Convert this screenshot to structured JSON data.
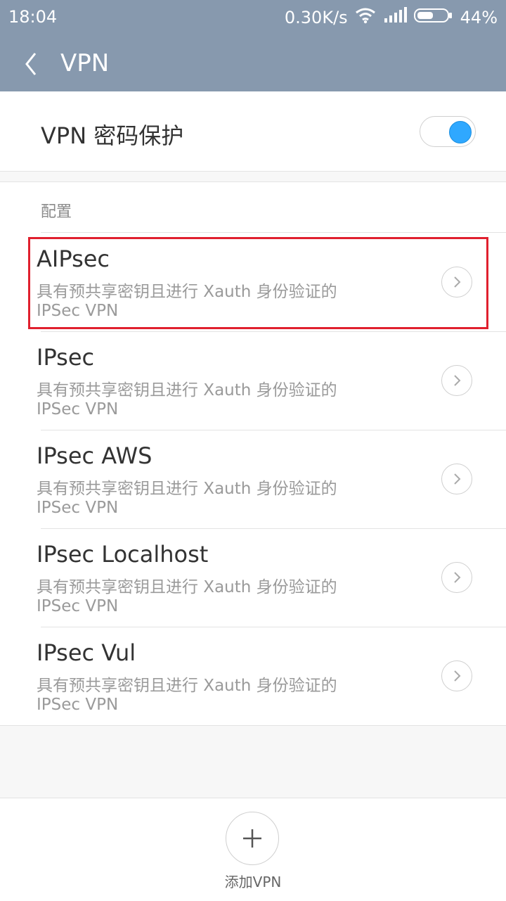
{
  "status_bar": {
    "time": "18:04",
    "speed": "0.30K/s",
    "battery": "44%"
  },
  "header": {
    "title": "VPN"
  },
  "password_protection": {
    "label": "VPN 密码保护",
    "enabled": true,
    "accent_color": "#2fa8ff"
  },
  "section": {
    "title": "配置",
    "items": [
      {
        "name": "AIPsec",
        "desc_line1": "具有预共享密钥且进行 Xauth 身份验证的",
        "desc_line2": "IPSec VPN"
      },
      {
        "name": "IPsec",
        "desc_line1": "具有预共享密钥且进行 Xauth 身份验证的",
        "desc_line2": "IPSec VPN"
      },
      {
        "name": "IPsec AWS",
        "desc_line1": "具有预共享密钥且进行 Xauth 身份验证的",
        "desc_line2": "IPSec VPN"
      },
      {
        "name": "IPsec Localhost",
        "desc_line1": "具有预共享密钥且进行 Xauth 身份验证的",
        "desc_line2": "IPSec VPN"
      },
      {
        "name": "IPsec Vul",
        "desc_line1": "具有预共享密钥且进行 Xauth 身份验证的",
        "desc_line2": "IPSec VPN"
      }
    ]
  },
  "add_vpn": {
    "label": "添加VPN"
  },
  "colors": {
    "header_bg": "#8799ae",
    "highlight": "#e0202e"
  },
  "icons": [
    "back-chevron-icon",
    "wifi-icon",
    "signal-icon",
    "battery-icon",
    "chevron-right-icon",
    "plus-icon"
  ]
}
